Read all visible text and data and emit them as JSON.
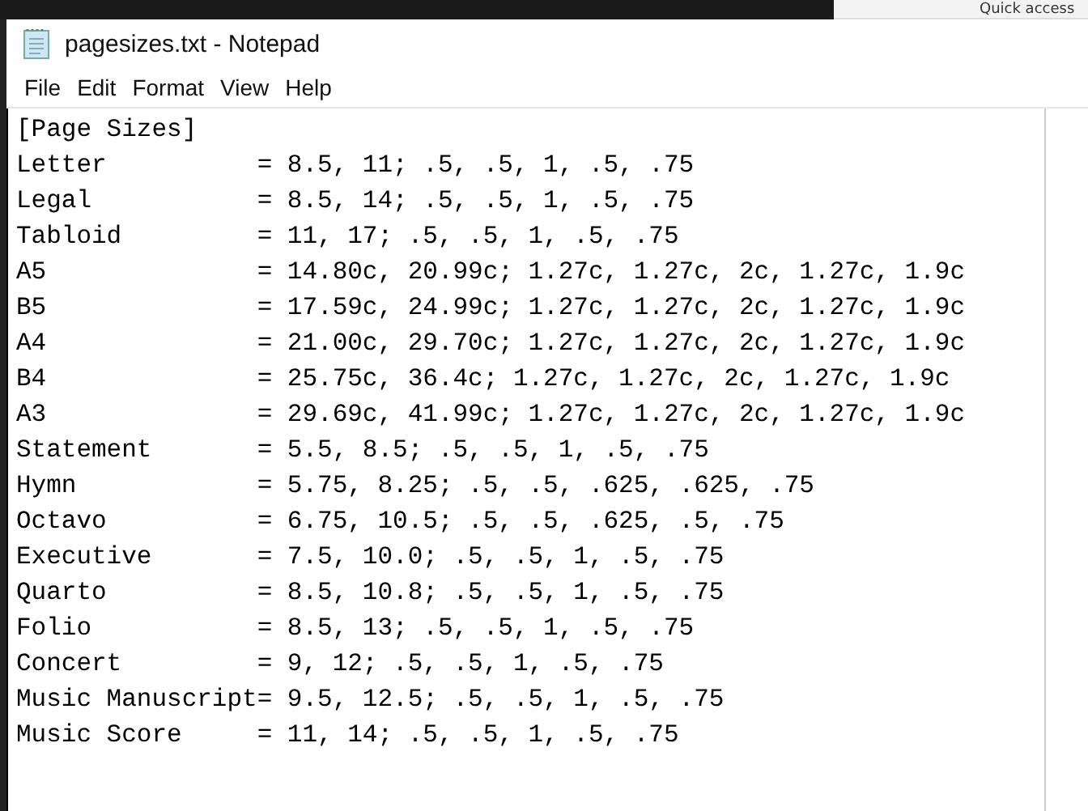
{
  "background_window": {
    "breadcrumb": "Quick access"
  },
  "window": {
    "title": "pagesizes.txt - Notepad"
  },
  "menu": [
    "File",
    "Edit",
    "Format",
    "View",
    "Help"
  ],
  "editor": {
    "lines": [
      "[Page Sizes]",
      "Letter          = 8.5, 11; .5, .5, 1, .5, .75",
      "Legal           = 8.5, 14; .5, .5, 1, .5, .75",
      "Tabloid         = 11, 17; .5, .5, 1, .5, .75",
      "A5              = 14.80c, 20.99c; 1.27c, 1.27c, 2c, 1.27c, 1.9c",
      "B5              = 17.59c, 24.99c; 1.27c, 1.27c, 2c, 1.27c, 1.9c",
      "A4              = 21.00c, 29.70c; 1.27c, 1.27c, 2c, 1.27c, 1.9c",
      "B4              = 25.75c, 36.4c; 1.27c, 1.27c, 2c, 1.27c, 1.9c",
      "A3              = 29.69c, 41.99c; 1.27c, 1.27c, 2c, 1.27c, 1.9c",
      "Statement       = 5.5, 8.5; .5, .5, 1, .5, .75",
      "Hymn            = 5.75, 8.25; .5, .5, .625, .625, .75",
      "Octavo          = 6.75, 10.5; .5, .5, .625, .5, .75",
      "Executive       = 7.5, 10.0; .5, .5, 1, .5, .75",
      "Quarto          = 8.5, 10.8; .5, .5, 1, .5, .75",
      "Folio           = 8.5, 13; .5, .5, 1, .5, .75",
      "Concert         = 9, 12; .5, .5, 1, .5, .75",
      "Music Manuscript= 9.5, 12.5; .5, .5, 1, .5, .75",
      "Music Score     = 11, 14; .5, .5, 1, .5, .75"
    ]
  }
}
